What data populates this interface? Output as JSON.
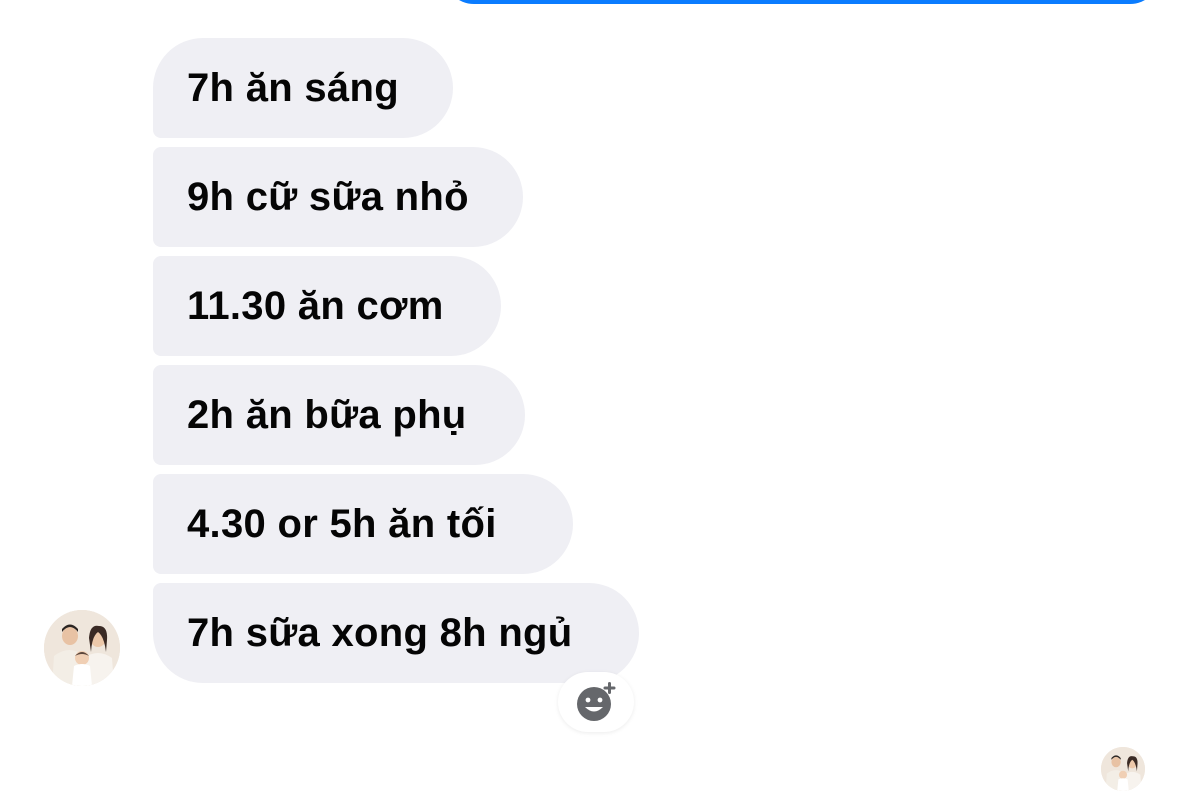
{
  "thread": {
    "messages": [
      {
        "text": "7h ăn sáng"
      },
      {
        "text": "9h cữ sữa nhỏ"
      },
      {
        "text": "11.30 ăn cơm"
      },
      {
        "text": "2h ăn bữa phụ"
      },
      {
        "text": "4.30 or 5h ăn tối"
      },
      {
        "text": "7h sữa xong 8h ngủ"
      }
    ]
  },
  "icons": {
    "react": "add-reaction-icon",
    "avatar": "sender-avatar",
    "seen": "seen-avatar"
  },
  "colors": {
    "sent_bubble": "#0a7cff",
    "received_bubble": "#efeff4",
    "text": "#050505",
    "icon": "#65676b"
  }
}
